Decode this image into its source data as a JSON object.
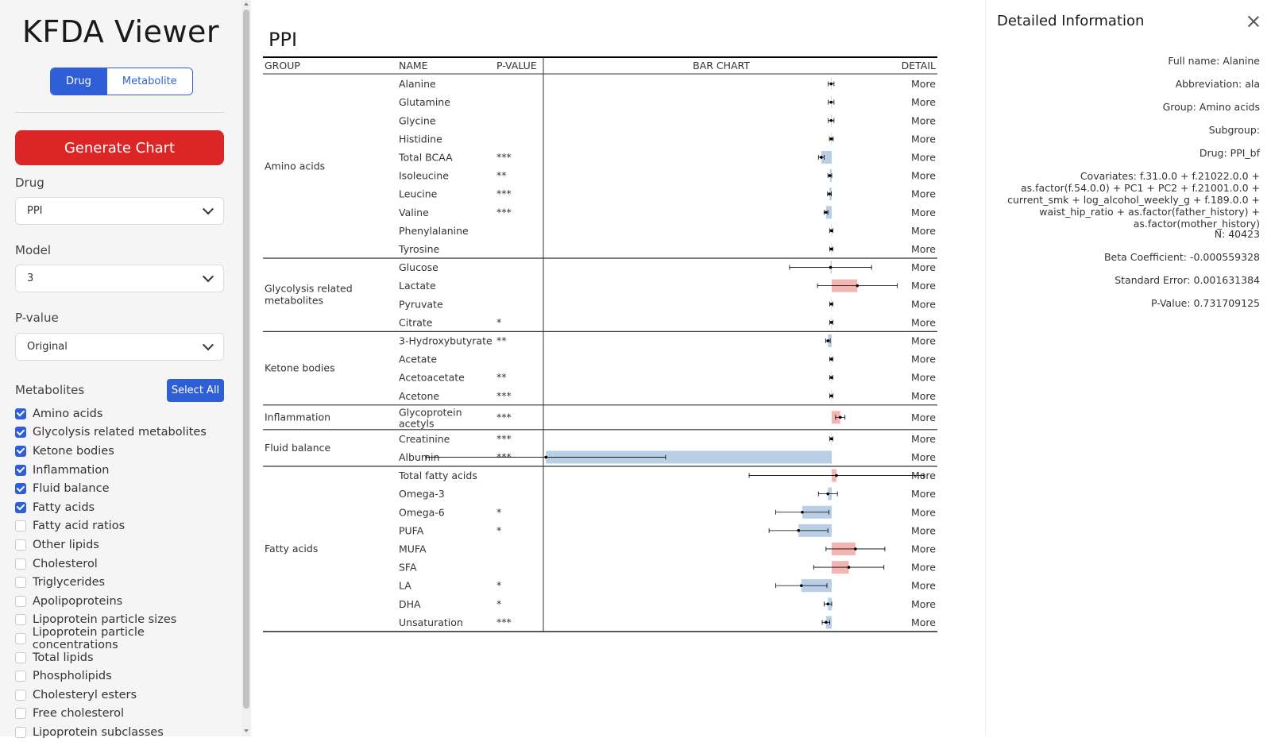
{
  "sidebar": {
    "title": "KFDA Viewer",
    "mode_tabs": [
      "Drug",
      "Metabolite"
    ],
    "active_mode": "Drug",
    "generate_label": "Generate Chart",
    "drug_label": "Drug",
    "drug_value": "PPI",
    "model_label": "Model",
    "model_value": "3",
    "pvalue_label": "P-value",
    "pvalue_value": "Original",
    "metabolites_label": "Metabolites",
    "select_all_label": "Select All",
    "metabolites": [
      {
        "label": "Amino acids",
        "checked": true
      },
      {
        "label": "Glycolysis related metabolites",
        "checked": true
      },
      {
        "label": "Ketone bodies",
        "checked": true
      },
      {
        "label": "Inflammation",
        "checked": true
      },
      {
        "label": "Fluid balance",
        "checked": true
      },
      {
        "label": "Fatty acids",
        "checked": true
      },
      {
        "label": "Fatty acid ratios",
        "checked": false
      },
      {
        "label": "Other lipids",
        "checked": false
      },
      {
        "label": "Cholesterol",
        "checked": false
      },
      {
        "label": "Triglycerides",
        "checked": false
      },
      {
        "label": "Apolipoproteins",
        "checked": false
      },
      {
        "label": "Lipoprotein particle sizes",
        "checked": false
      },
      {
        "label": "Lipoprotein particle concentrations",
        "checked": false
      },
      {
        "label": "Total lipids",
        "checked": false
      },
      {
        "label": "Phospholipids",
        "checked": false
      },
      {
        "label": "Cholesteryl esters",
        "checked": false
      },
      {
        "label": "Free cholesterol",
        "checked": false
      },
      {
        "label": "Lipoprotein subclasses",
        "checked": false
      }
    ]
  },
  "main": {
    "title": "PPI",
    "headers": {
      "group": "GROUP",
      "name": "NAME",
      "pvalue": "P-VALUE",
      "chart": "BAR CHART",
      "detail": "DETAIL"
    },
    "more_label": "More",
    "colors": {
      "positive": "#f4b4b1",
      "negative": "#b8cfe6",
      "line": "#000000"
    }
  },
  "chart_data": {
    "type": "bar",
    "orientation": "horizontal forest plot (beta coefficient with error bars)",
    "groups": [
      {
        "label": "Amino acids",
        "rows": [
          {
            "name": "Alanine",
            "p": "",
            "beta": -0.0003,
            "err": 0.0015
          },
          {
            "name": "Glutamine",
            "p": "",
            "beta": -0.0003,
            "err": 0.0015
          },
          {
            "name": "Glycine",
            "p": "",
            "beta": -0.0003,
            "err": 0.0015
          },
          {
            "name": "Histidine",
            "p": "",
            "beta": -0.0002,
            "err": 0.001
          },
          {
            "name": "Total BCAA",
            "p": "***",
            "beta": -0.0055,
            "err": 0.0015
          },
          {
            "name": "Isoleucine",
            "p": "**",
            "beta": -0.001,
            "err": 0.001
          },
          {
            "name": "Leucine",
            "p": "***",
            "beta": -0.0012,
            "err": 0.001
          },
          {
            "name": "Valine",
            "p": "***",
            "beta": -0.003,
            "err": 0.001
          },
          {
            "name": "Phenylalanine",
            "p": "",
            "beta": -0.0002,
            "err": 0.0008
          },
          {
            "name": "Tyrosine",
            "p": "",
            "beta": -0.0002,
            "err": 0.0008
          }
        ]
      },
      {
        "label": "Glycolysis related metabolites",
        "rows": [
          {
            "name": "Glucose",
            "p": "",
            "beta": -0.0006,
            "err": 0.0216
          },
          {
            "name": "Lactate",
            "p": "",
            "beta": 0.0135,
            "err": 0.021
          },
          {
            "name": "Pyruvate",
            "p": "",
            "beta": -0.0002,
            "err": 0.0008
          },
          {
            "name": "Citrate",
            "p": "*",
            "beta": -0.0002,
            "err": 0.0008
          }
        ]
      },
      {
        "label": "Ketone bodies",
        "rows": [
          {
            "name": "3-Hydroxybutyrate",
            "p": "**",
            "beta": -0.002,
            "err": 0.0012
          },
          {
            "name": "Acetate",
            "p": "",
            "beta": -0.0002,
            "err": 0.0008
          },
          {
            "name": "Acetoacetate",
            "p": "**",
            "beta": -0.0002,
            "err": 0.0008
          },
          {
            "name": "Acetone",
            "p": "***",
            "beta": -0.0002,
            "err": 0.0008
          }
        ]
      },
      {
        "label": "Inflammation",
        "rows": [
          {
            "name": "Glycoprotein acetyls",
            "p": "***",
            "beta": 0.0045,
            "err": 0.0025
          }
        ]
      },
      {
        "label": "Fluid balance",
        "rows": [
          {
            "name": "Creatinine",
            "p": "***",
            "beta": -0.0002,
            "err": 0.0008
          },
          {
            "name": "Albumin",
            "p": "***",
            "beta": -0.1505,
            "err": 0.063
          }
        ]
      },
      {
        "label": "Fatty acids",
        "rows": [
          {
            "name": "Total fatty acids",
            "p": "",
            "beta": 0.0025,
            "err": 0.046
          },
          {
            "name": "Omega-3",
            "p": "",
            "beta": -0.002,
            "err": 0.005
          },
          {
            "name": "Omega-6",
            "p": "*",
            "beta": -0.0155,
            "err": 0.014
          },
          {
            "name": "PUFA",
            "p": "*",
            "beta": -0.0175,
            "err": 0.0155
          },
          {
            "name": "MUFA",
            "p": "",
            "beta": 0.0125,
            "err": 0.0155
          },
          {
            "name": "SFA",
            "p": "",
            "beta": 0.009,
            "err": 0.0185
          },
          {
            "name": "LA",
            "p": "*",
            "beta": -0.016,
            "err": 0.0135
          },
          {
            "name": "DHA",
            "p": "*",
            "beta": -0.002,
            "err": 0.002
          },
          {
            "name": "Unsaturation",
            "p": "***",
            "beta": -0.003,
            "err": 0.002
          }
        ]
      }
    ]
  },
  "detail": {
    "title": "Detailed Information",
    "full_name": "Full name: Alanine",
    "abbreviation": "Abbreviation: ala",
    "group": "Group: Amino acids",
    "subgroup": "Subgroup:",
    "drug": "Drug: PPI_bf",
    "covariates": "Covariates: f.31.0.0 + f.21022.0.0 + as.factor(f.54.0.0) + PC1 + PC2 + f.21001.0.0 + current_smk + log_alcohol_weekly_g + f.189.0.0 + waist_hip_ratio + as.factor(father_history) + as.factor(mother_history)",
    "n": "N: 40423",
    "beta": "Beta Coefficient: -0.000559328",
    "se": "Standard Error: 0.001631384",
    "pvalue": "P-Value: 0.731709125"
  }
}
